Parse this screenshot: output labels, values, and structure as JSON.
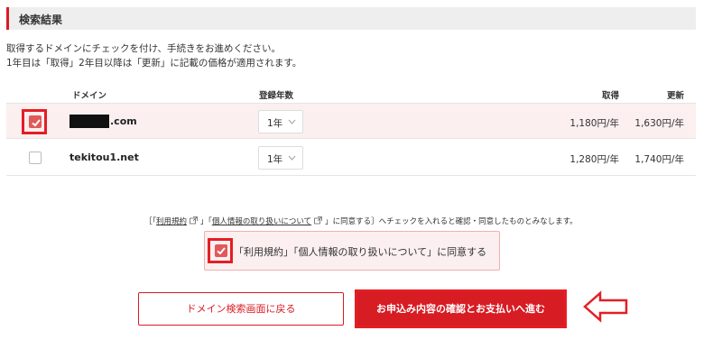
{
  "section": {
    "title": "検索結果"
  },
  "description": {
    "line1": "取得するドメインにチェックを付け、手続きをお進めください。",
    "line2": "1年目は「取得」2年目以降は「更新」に記載の価格が適用されます。"
  },
  "table": {
    "headers": {
      "domain": "ドメイン",
      "years": "登録年数",
      "acquire": "取得",
      "renew": "更新"
    },
    "rows": [
      {
        "domain_suffix": ".com",
        "domain_masked": true,
        "checked": true,
        "years": "1年",
        "acquire": "1,180円/年",
        "renew": "1,630円/年"
      },
      {
        "domain": "tekitou1.net",
        "checked": false,
        "years": "1年",
        "acquire": "1,280円/年",
        "renew": "1,740円/年"
      }
    ]
  },
  "agreement": {
    "note_prefix": "［「",
    "terms_link": "利用規約",
    "note_mid": "」「",
    "privacy_link": "個人情報の取り扱いについて",
    "note_suffix": "」に同意する］へチェックを入れると確認・同意したものとみなします。",
    "checkbox_label": "「利用規約」「個人情報の取り扱いについて」に同意する",
    "checked": true
  },
  "buttons": {
    "back": "ドメイン検索画面に戻る",
    "next": "お申込み内容の確認とお支払いへ進む"
  },
  "colors": {
    "accent": "#d71c24",
    "row_highlight": "#fbefef",
    "checkbox": "#e05a5a",
    "annotation": "#e41e24"
  }
}
